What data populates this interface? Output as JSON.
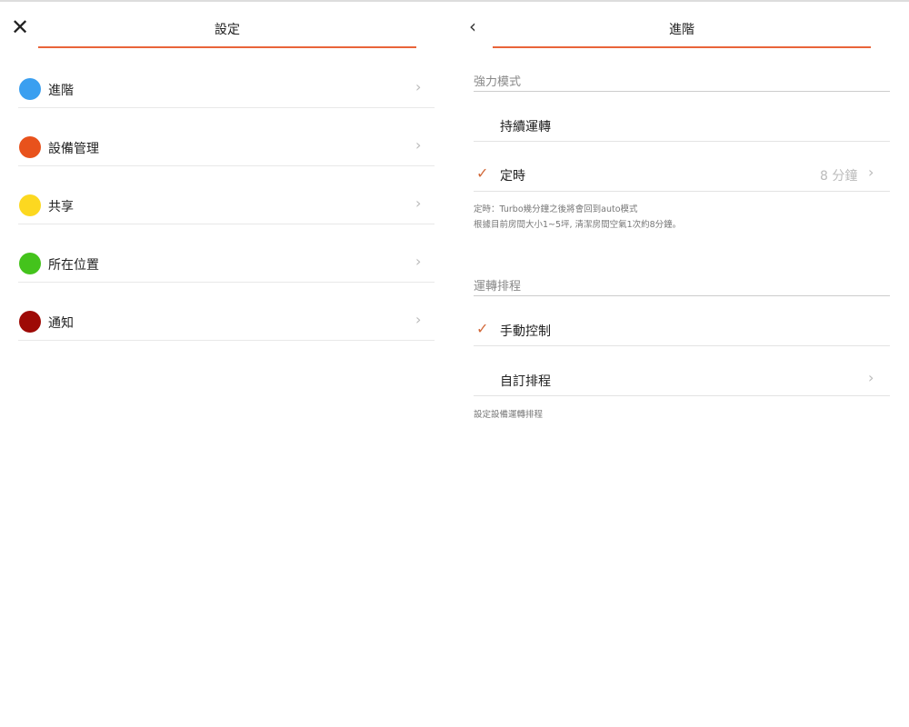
{
  "left": {
    "title": "設定",
    "close_icon": "close-icon",
    "items": [
      {
        "label": "進階",
        "color": "#3a9ff0"
      },
      {
        "label": "設備管理",
        "color": "#e8521c"
      },
      {
        "label": "共享",
        "color": "#fcd820"
      },
      {
        "label": "所在位置",
        "color": "#44c31c"
      },
      {
        "label": "通知",
        "color": "#9e0a06"
      }
    ]
  },
  "right": {
    "title": "進階",
    "section1": {
      "header": "強力模式",
      "continuous": "持續運轉",
      "timer": "定時",
      "timer_value": "8 分鐘",
      "note1": "定時：Turbo幾分鐘之後將會回到auto模式",
      "note2": "根據目前房間大小1~5坪, 清潔房間空氣1次約8分鐘。"
    },
    "section2": {
      "header": "運轉排程",
      "manual": "手動控制",
      "custom": "自訂排程",
      "note": "設定設備運轉排程"
    }
  },
  "accent": "#e9643a"
}
